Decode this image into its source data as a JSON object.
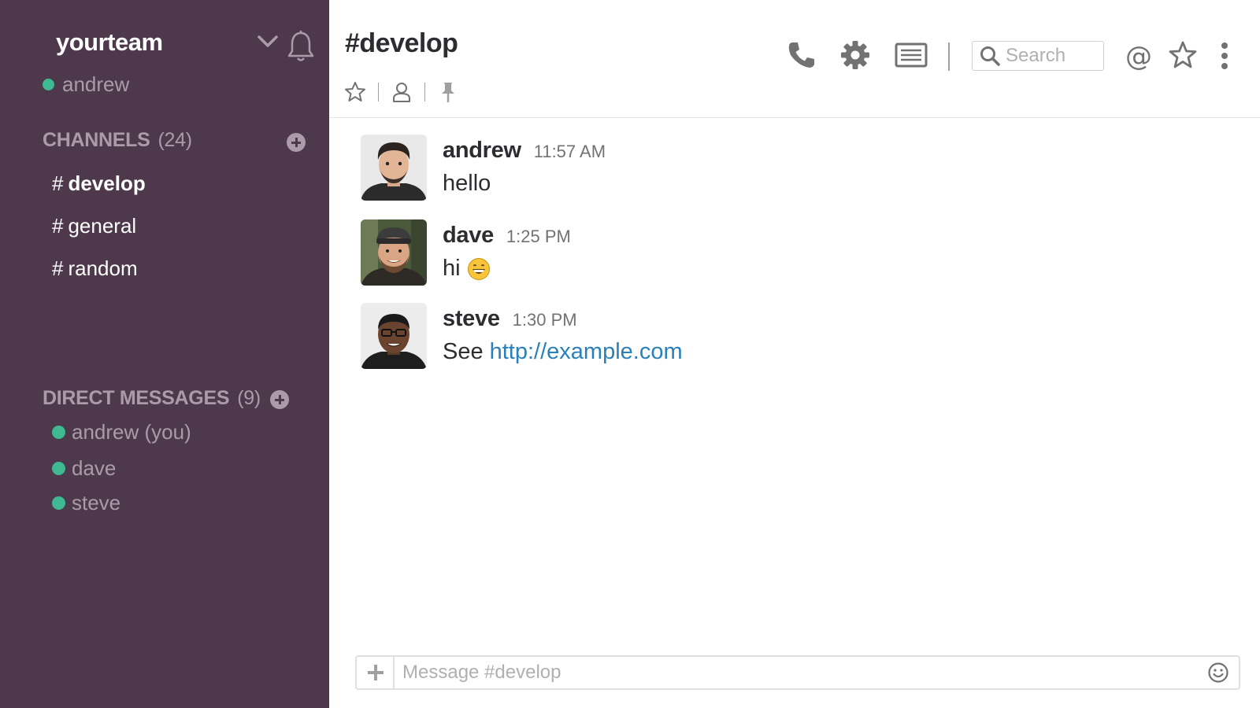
{
  "sidebar": {
    "team_name": "yourteam",
    "current_user": "andrew",
    "channels_label": "CHANNELS",
    "channels_count": "(24)",
    "channels": [
      {
        "hash": "#",
        "name": "develop",
        "active": true
      },
      {
        "hash": "#",
        "name": "general",
        "active": false
      },
      {
        "hash": "#",
        "name": "random",
        "active": false
      }
    ],
    "dms_label": "DIRECT MESSAGES",
    "dms_count": "(9)",
    "dms": [
      {
        "name": "andrew (you)",
        "status": "online"
      },
      {
        "name": "dave",
        "status": "online"
      },
      {
        "name": "steve",
        "status": "online"
      }
    ]
  },
  "header": {
    "channel_title": "#develop",
    "search_placeholder": "Search"
  },
  "messages": [
    {
      "author": "andrew",
      "time": "11:57 AM",
      "text": "hello",
      "link": ""
    },
    {
      "author": "dave",
      "time": "1:25 PM",
      "text": "hi",
      "emoji": "grinning-face",
      "link": ""
    },
    {
      "author": "steve",
      "time": "1:30 PM",
      "text": "See",
      "link": "http://example.com"
    }
  ],
  "composer": {
    "placeholder": "Message #develop"
  },
  "colors": {
    "sidebar_bg": "#4d394b",
    "sidebar_muted": "#ab9ba9",
    "presence_online": "#3eb991",
    "link": "#2a80b9",
    "text_primary": "#2c2d30",
    "timestamp": "#717274"
  }
}
